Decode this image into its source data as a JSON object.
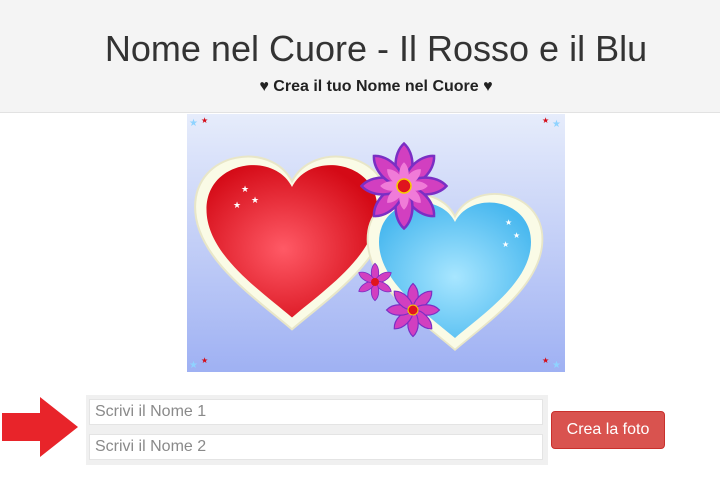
{
  "header": {
    "title": "Nome nel Cuore - Il Rosso e il Blu",
    "subtitle": "♥ Crea il tuo Nome nel Cuore ♥"
  },
  "form": {
    "name1_placeholder": "Scrivi il Nome 1",
    "name1_value": "",
    "name2_placeholder": "Scrivi il Nome 2",
    "name2_value": "",
    "submit_label": "Crea la foto"
  },
  "colors": {
    "header_bg": "#f4f4f4",
    "button_bg": "#d9534f",
    "arrow": "#e8242a",
    "heart_red": "#e0141e",
    "heart_blue": "#62c6f2",
    "flower_pink": "#d23fc0",
    "background_gradient_top": "#e6ecfb",
    "background_gradient_bottom": "#9fb1f3"
  },
  "icons": {
    "arrow": "right-arrow-icon",
    "hearts": "heart-icon",
    "flowers": "flower-icon",
    "stars": "star-icon"
  }
}
